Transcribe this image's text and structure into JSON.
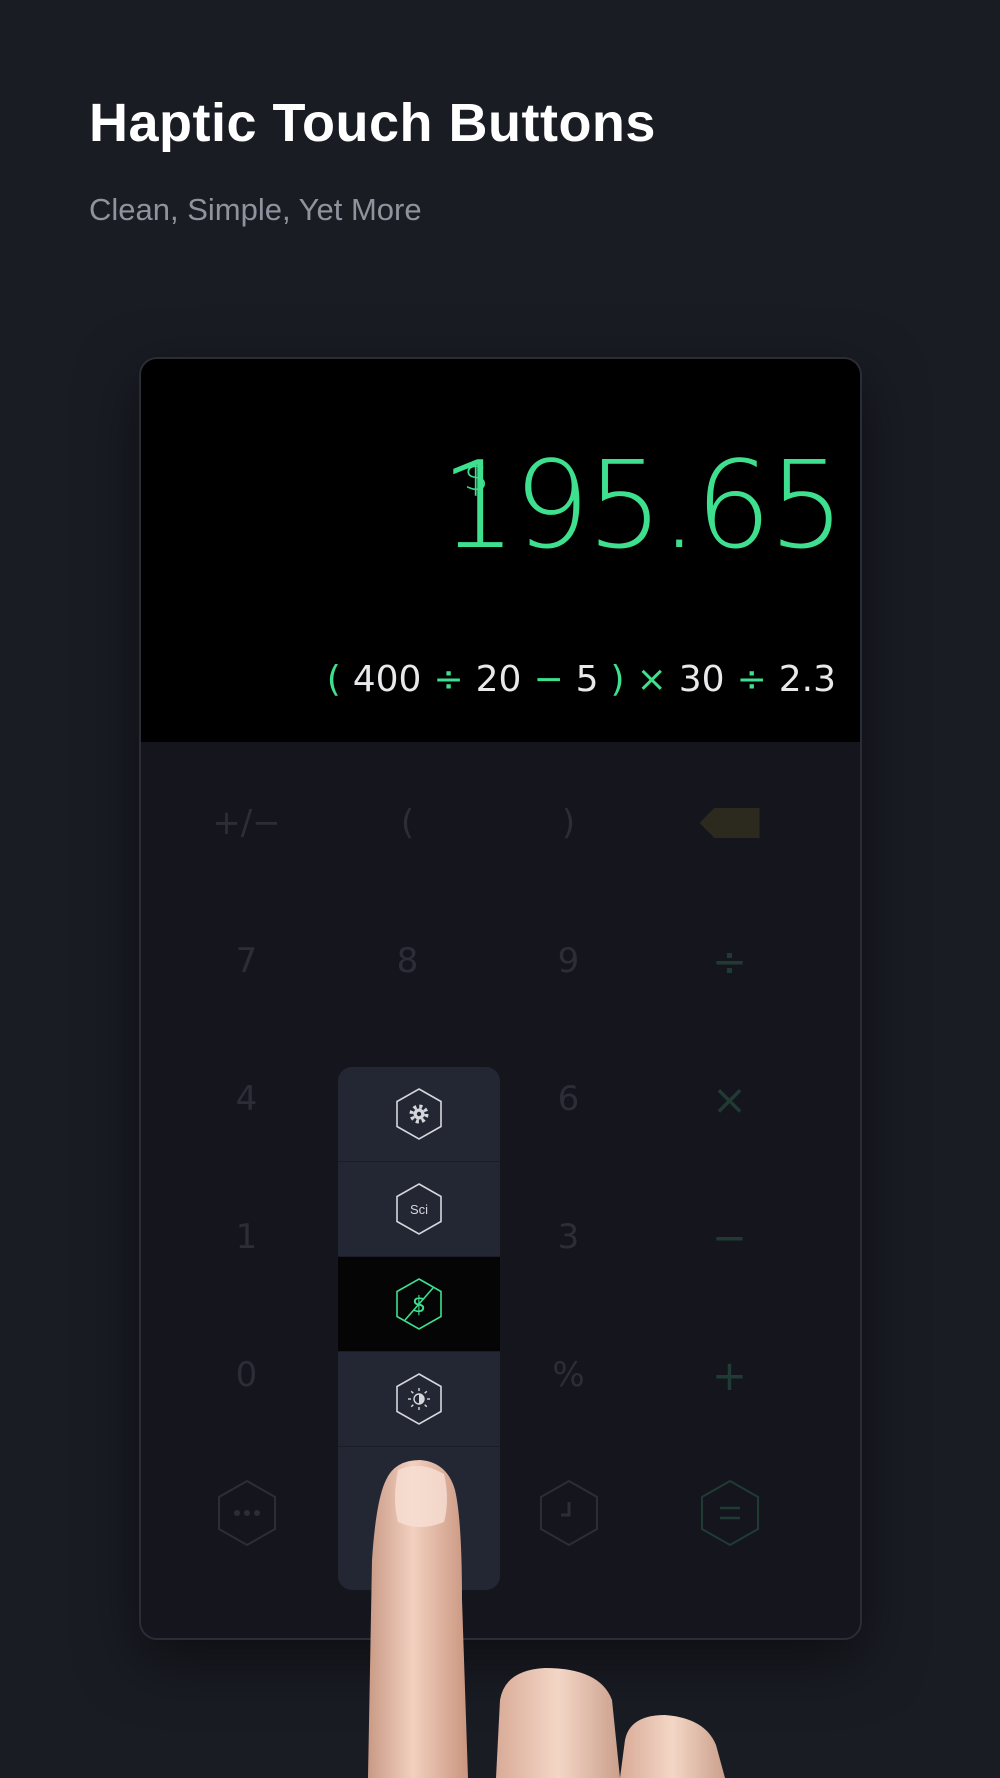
{
  "header": {
    "title": "Haptic Touch Buttons",
    "subtitle": "Clean, Simple, Yet More"
  },
  "display": {
    "currency_symbol": "$",
    "result": "195.65",
    "expression": [
      {
        "t": "(",
        "kind": "op"
      },
      {
        "t": "400",
        "kind": "num"
      },
      {
        "t": "÷",
        "kind": "op"
      },
      {
        "t": "20",
        "kind": "num"
      },
      {
        "t": "−",
        "kind": "op"
      },
      {
        "t": "5",
        "kind": "num"
      },
      {
        "t": ")",
        "kind": "op"
      },
      {
        "t": "×",
        "kind": "op"
      },
      {
        "t": "30",
        "kind": "num"
      },
      {
        "t": "÷",
        "kind": "op"
      },
      {
        "t": "2.3",
        "kind": "num"
      }
    ]
  },
  "keys": {
    "plus_minus": "+/−",
    "open_paren": "(",
    "close_paren": ")",
    "seven": "7",
    "eight": "8",
    "nine": "9",
    "divide": "÷",
    "four": "4",
    "six": "6",
    "multiply": "×",
    "one": "1",
    "three": "3",
    "minus": "−",
    "zero": "0",
    "percent": "%",
    "plus": "+"
  },
  "menu": {
    "sci_label": "Sci",
    "currency_label": "$"
  },
  "colors": {
    "accent": "#3ee08f",
    "background": "#1a1c24",
    "display_bg": "#000000",
    "menu_bg": "#232733"
  },
  "icons": {
    "settings": "gear-icon",
    "scientific": "sci-icon",
    "currency": "currency-off-icon",
    "theme": "brightness-icon",
    "more": "more-icon",
    "history": "clock-icon",
    "equals": "equals-icon",
    "backspace": "backspace-icon"
  }
}
